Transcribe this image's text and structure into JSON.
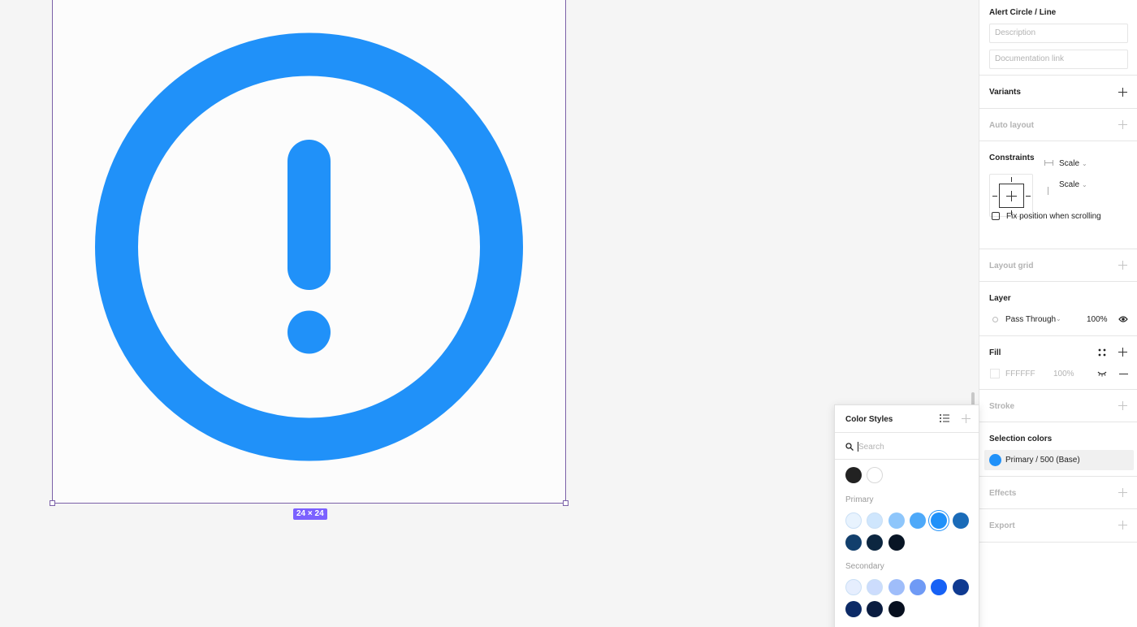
{
  "canvas": {
    "frame_size_label": "24 × 24",
    "icon_color": "#2091f9"
  },
  "panel": {
    "component_name": "Alert Circle / Line",
    "description_placeholder": "Description",
    "doc_link_placeholder": "Documentation link",
    "variants_label": "Variants",
    "auto_layout_label": "Auto layout",
    "constraints_label": "Constraints",
    "constraint_h": "Scale",
    "constraint_v": "Scale",
    "fix_position_label": "Fix position when scrolling",
    "layout_grid_label": "Layout grid",
    "layer_label": "Layer",
    "blend_mode": "Pass Through",
    "layer_opacity": "100%",
    "fill_label": "Fill",
    "fill_hex": "FFFFFF",
    "fill_opacity": "100%",
    "stroke_label": "Stroke",
    "selection_colors_label": "Selection colors",
    "selection_color_name": "Primary / 500 (Base)",
    "selection_color_hex": "#2091f9",
    "effects_label": "Effects",
    "export_label": "Export"
  },
  "color_styles": {
    "title": "Color Styles",
    "search_placeholder": "Search",
    "base": [
      "#222222",
      "#ffffff"
    ],
    "primary_label": "Primary",
    "primary": [
      "#e8f3fe",
      "#cfe6fd",
      "#8ec6fb",
      "#4ea9f9",
      "#2091f9",
      "#1a6bb8",
      "#123f6c",
      "#0c2640",
      "#081525"
    ],
    "secondary_label": "Secondary",
    "secondary": [
      "#e6eefe",
      "#ccdcfd",
      "#9fbdfa",
      "#6f9af5",
      "#1661f5",
      "#0f3a91",
      "#0c2a66",
      "#0a1c40",
      "#070f1f"
    ]
  }
}
